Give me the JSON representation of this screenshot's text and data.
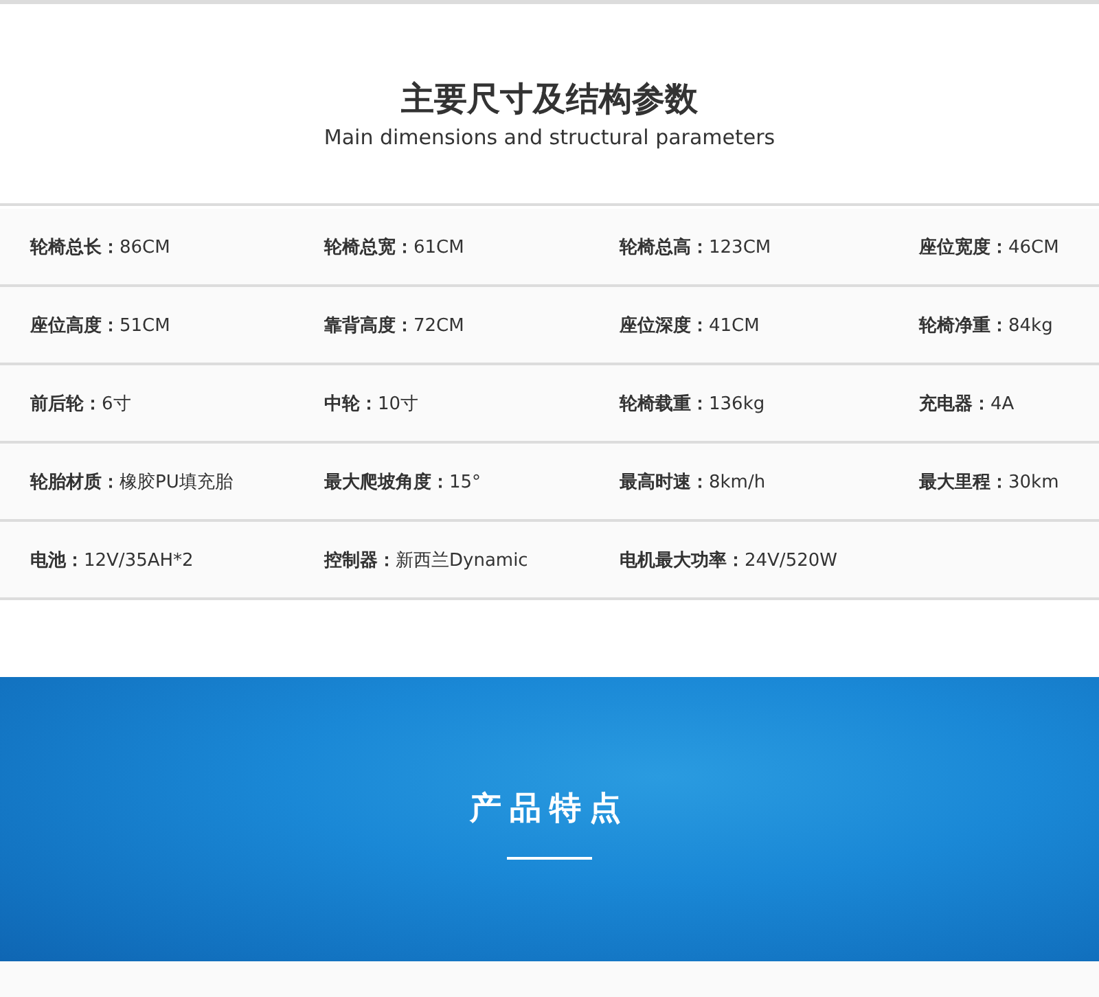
{
  "header": {
    "title": "主要尺寸及结构参数",
    "subtitle": "Main dimensions and structural parameters"
  },
  "spec_rows": [
    {
      "cells": [
        "**轮椅总长：**86CM",
        "**轮椅总宽：**61CM",
        "**轮椅总高：**123CM",
        "**座位宽度：**46CM"
      ]
    },
    {
      "cells": [
        "**座位高度：**51CM",
        "**靠背高度：**72CM",
        "**座位深度：**41CM",
        "**轮椅净重：**84kg"
      ]
    },
    {
      "cells": [
        "**前后轮：**6寸",
        "**中轮：**10寸",
        "**轮椅载重：**136kg",
        "**充电器：**4A"
      ]
    },
    {
      "cells": [
        "**轮胎材质：**橡胶PU填充胎",
        "**最大爬坡角度：**15°",
        "**最高时速：**8km/h",
        "**最大里程：**30km"
      ]
    },
    {
      "cells": [
        "**电池：**12V/35AH*2",
        "**控制器：**新西兰Dynamic",
        "**电机最大功率：**24V/520W"
      ]
    }
  ],
  "banner": {
    "title": "产品特点"
  }
}
